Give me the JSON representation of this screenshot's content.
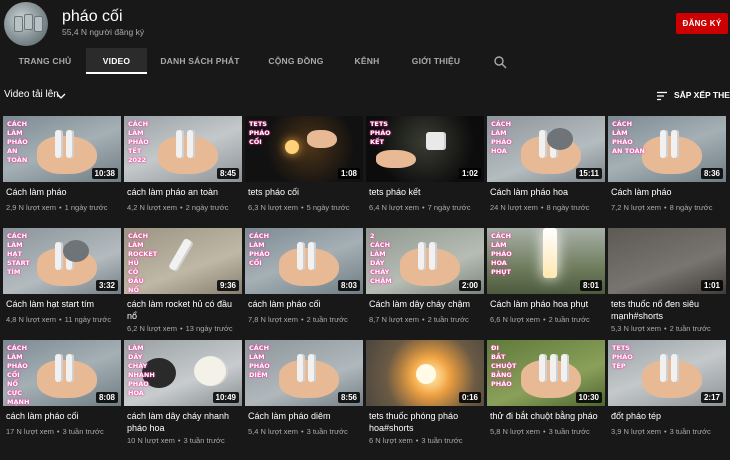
{
  "channel": {
    "name": "pháo cối",
    "subscribers": "55,4 N người đăng ký",
    "subscribe_label": "ĐĂNG KÝ"
  },
  "tabs": [
    "TRANG CHỦ",
    "VIDEO",
    "DANH SÁCH PHÁT",
    "CỘNG ĐỒNG",
    "KÊNH",
    "GIỚI THIỆU"
  ],
  "active_tab": "VIDEO",
  "toolbar": {
    "filter_label": "Video tải lên",
    "sort_label": "SẮP XẾP THEO"
  },
  "colors": {
    "background": "#181818",
    "subscribe": "#cc0000",
    "secondary_text": "#aaaaaa"
  },
  "videos": [
    {
      "title": "Cách làm pháo",
      "views": "2,9 N lượt xem",
      "age": "1 ngày trước",
      "duration": "10:38",
      "overlay": [
        "CÁCH",
        "LÀM",
        "PHÁO",
        "AN",
        "TOÀN"
      ],
      "thumb": "hand-tubes"
    },
    {
      "title": "cách làm pháo an toàn",
      "views": "4,2 N lượt xem",
      "age": "2 ngày trước",
      "duration": "8:45",
      "overlay": [
        "CÁCH",
        "LÀM",
        "PHÁO",
        "TẾT",
        "2022"
      ],
      "thumb": "tubes-paper"
    },
    {
      "title": "tets pháo cối",
      "views": "6,3 N lượt xem",
      "age": "5 ngày trước",
      "duration": "1:08",
      "overlay": [
        "TETS",
        "PHÁO",
        "CỐI"
      ],
      "thumb": "dark-fire"
    },
    {
      "title": "tets pháo kết",
      "views": "6,4 N lượt xem",
      "age": "7 ngày trước",
      "duration": "1:02",
      "overlay": [
        "TETS",
        "PHÁO",
        "KẾT"
      ],
      "thumb": "dark-hand"
    },
    {
      "title": "Cách làm pháo hoa",
      "views": "24 N lượt xem",
      "age": "8 ngày trước",
      "duration": "15:11",
      "overlay": [
        "CÁCH",
        "LÀM",
        "PHÁO",
        "HOA"
      ],
      "thumb": "hand-bowl"
    },
    {
      "title": "Cách làm pháo",
      "views": "7,2 N lượt xem",
      "age": "8 ngày trước",
      "duration": "8:36",
      "overlay": [
        "CÁCH",
        "LÀM",
        "PHÁO",
        "AN TOÀN"
      ],
      "thumb": "hand-tubes"
    },
    {
      "title": "Cách làm hạt start tím",
      "views": "4,8 N lượt xem",
      "age": "11 ngày trước",
      "duration": "3:32",
      "overlay": [
        "CÁCH",
        "LÀM",
        "HẠT",
        "START",
        "TÍM"
      ],
      "thumb": "hand-pellets"
    },
    {
      "title": "cách làm rocket hủ có đầu nổ",
      "views": "6,2 N lượt xem",
      "age": "13 ngày trước",
      "duration": "9:36",
      "overlay": [
        "CÁCH",
        "LÀM",
        "ROCKET",
        "HỦ",
        "CÓ",
        "ĐẦU",
        "NỔ"
      ],
      "thumb": "ground-rocket"
    },
    {
      "title": "cách làm pháo cối",
      "views": "7,8 N lượt xem",
      "age": "2 tuần trước",
      "duration": "8:03",
      "overlay": [
        "CÁCH",
        "LÀM",
        "PHÁO",
        "CỐI"
      ],
      "thumb": "hand-tubes"
    },
    {
      "title": "Cách làm dây cháy chậm",
      "views": "8,7 N lượt xem",
      "age": "2 tuần trước",
      "duration": "2:00",
      "overlay": [
        "2",
        "CÁCH",
        "LÀM",
        "DÂY",
        "CHÁY",
        "CHẬM"
      ],
      "thumb": "hand-fuse"
    },
    {
      "title": "Cách làm pháo hoa phụt",
      "views": "6,6 N lượt xem",
      "age": "2 tuần trước",
      "duration": "8:01",
      "overlay": [
        "CÁCH",
        "LÀM",
        "PHÁO",
        "HOA",
        "PHỤT"
      ],
      "thumb": "fountain"
    },
    {
      "title": "tets thuốc nổ đen siêu mạnh#shorts",
      "views": "5,3 N lượt xem",
      "age": "2 tuần trước",
      "duration": "1:01",
      "overlay": [],
      "thumb": "ground-dark"
    },
    {
      "title": "cách làm pháo cối",
      "views": "17 N lượt xem",
      "age": "3 tuần trước",
      "duration": "8:08",
      "overlay": [
        "CÁCH",
        "LÀM",
        "PHÁO",
        "CỐI",
        "NỔ",
        "CỰC",
        "MẠNH"
      ],
      "thumb": "hand-tubes"
    },
    {
      "title": "cách làm dây cháy nhanh pháo hoa",
      "views": "10 N lượt xem",
      "age": "3 tuần trước",
      "duration": "10:49",
      "overlay": [
        "LÀM",
        "DÂY",
        "CHÁY",
        "NHANH",
        "PHÁO",
        "HOA"
      ],
      "thumb": "bowls"
    },
    {
      "title": "Cách làm pháo diêm",
      "views": "5,4 N lượt xem",
      "age": "3 tuần trước",
      "duration": "8:56",
      "overlay": [
        "CÁCH",
        "LÀM",
        "PHÁO",
        "DIÊM"
      ],
      "thumb": "hand-matches"
    },
    {
      "title": "tets thuốc phóng pháo hoa#shorts",
      "views": "6 N lượt xem",
      "age": "3 tuần trước",
      "duration": "0:16",
      "overlay": [],
      "thumb": "explosion"
    },
    {
      "title": "thử đi bắt chuột bằng pháo",
      "views": "5,8 N lượt xem",
      "age": "3 tuần trước",
      "duration": "10:30",
      "overlay": [
        "ĐI",
        "BẮT",
        "CHUỘT",
        "BẰNG",
        "PHÁO"
      ],
      "thumb": "hand-tubes-green"
    },
    {
      "title": "đốt pháo tép",
      "views": "3,9 N lượt xem",
      "age": "3 tuần trước",
      "duration": "2:17",
      "overlay": [
        "TETS",
        "PHÁO",
        "TÉP"
      ],
      "thumb": "tubes-paper"
    }
  ]
}
